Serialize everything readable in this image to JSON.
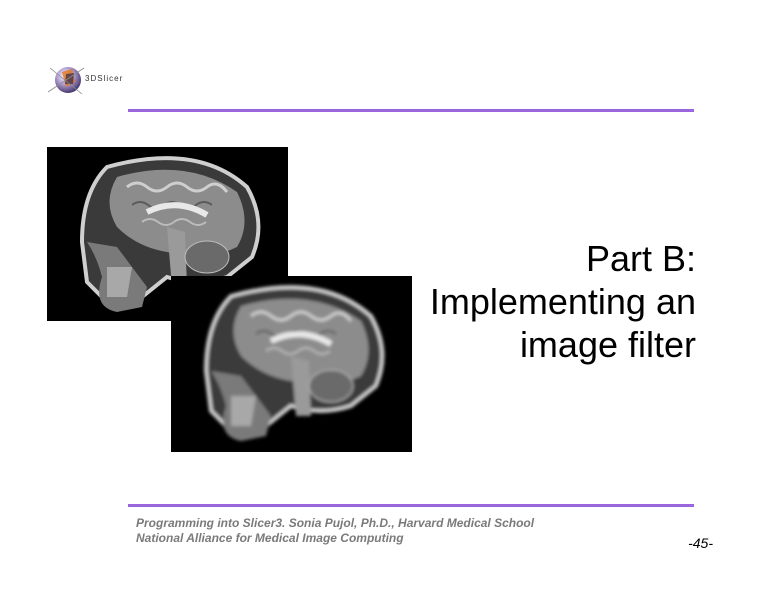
{
  "header": {
    "logo_text": "3DSlicer"
  },
  "colors": {
    "rule": "#9966dd",
    "footer_text": "#7a7a7a"
  },
  "title": {
    "line1": "Part B:",
    "line2": "Implementing an",
    "line3": "image filter"
  },
  "images": [
    {
      "name": "MRI sagittal brain slice (original)"
    },
    {
      "name": "MRI sagittal brain slice (filtered)"
    }
  ],
  "footer": {
    "line1": "Programming into Slicer3. Sonia Pujol, Ph.D., Harvard Medical School",
    "line2": "National Alliance for Medical Image Computing"
  },
  "page_number": "-45-"
}
